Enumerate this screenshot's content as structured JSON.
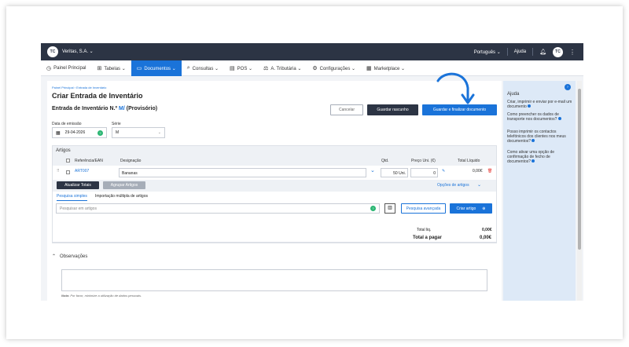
{
  "topbar": {
    "logo_text": "TC",
    "company": "Veritas, S.A. ⌄",
    "language": "Português ⌄",
    "help": "Ajuda",
    "bell_icon": "bell-icon",
    "avatar_text": "TC",
    "more_icon": "⋮"
  },
  "menu": [
    {
      "label": "Painel Principal",
      "icon": "◷"
    },
    {
      "label": "Tabelas ⌄",
      "icon": "⊞"
    },
    {
      "label": "Documentos ⌄",
      "icon": "▭"
    },
    {
      "label": "Consultas ⌄",
      "icon": "⌕"
    },
    {
      "label": "POS ⌄",
      "icon": "▤"
    },
    {
      "label": "A. Tributária ⌄",
      "icon": "⚖"
    },
    {
      "label": "Configurações ⌄",
      "icon": "⚙"
    },
    {
      "label": "Marketplace ⌄",
      "icon": "▦"
    }
  ],
  "breadcrumb": "Painel Principal  ›  Entrada de Inventário",
  "page_title": "Criar Entrada de Inventário",
  "doc_title_prefix": "Entrada de Inventário N.º",
  "doc_title_num": "M/",
  "doc_title_suffix": "(Provisório)",
  "buttons": {
    "cancel": "Cancelar",
    "draft": "Guardar rascunho",
    "final": "Guardar e finalizar documento"
  },
  "form": {
    "date_label": "Data de emissão",
    "date_value": "29-04-2026",
    "series_label": "Série",
    "series_value": "M"
  },
  "artigos": {
    "title": "Artigos",
    "columns": {
      "ref": "Referência/EAN",
      "designacao": "Designação",
      "qtd": "Qtd.",
      "preco": "Preço Uni. (€)",
      "total": "Total Líquido"
    },
    "row": {
      "ref": "ART007",
      "designacao": "Bananas",
      "qtd": "50 Uni.",
      "preco": "0",
      "total": "0,00€"
    },
    "btn_update": "Atualizar Totais",
    "btn_group": "Agrupar Artigos",
    "options": "Opções de artigos"
  },
  "tabs": {
    "simple": "Pesquisa simples",
    "multiple": "Importação múltipla de artigos"
  },
  "search": {
    "placeholder": "Pesquisar em artigos",
    "advanced": "Pesquisa avançada",
    "create": "Criar artigo"
  },
  "totals": {
    "liq_label": "Total liq.",
    "liq_value": "0,00€",
    "pay_label": "Total a pagar",
    "pay_value": "0,00€"
  },
  "obs": {
    "title": "Observações",
    "note_label": "Nota:",
    "note_text": "Por favor, minimize a utilização de dados pessoais."
  },
  "help": {
    "title": "Ajuda",
    "links": [
      "Criar, imprimir e enviar por e-mail um documento",
      "Como preencher os dados de transporte nos documentos?",
      "Posso imprimir os contactos telefónicos dos clientes nos meus documentos?",
      "Como ativar uma opção de confirmação de fecho de documentos?"
    ]
  },
  "colors": {
    "accent": "#1a73d9",
    "dark": "#2c3444",
    "success": "#2bb673",
    "danger": "#e53935"
  }
}
